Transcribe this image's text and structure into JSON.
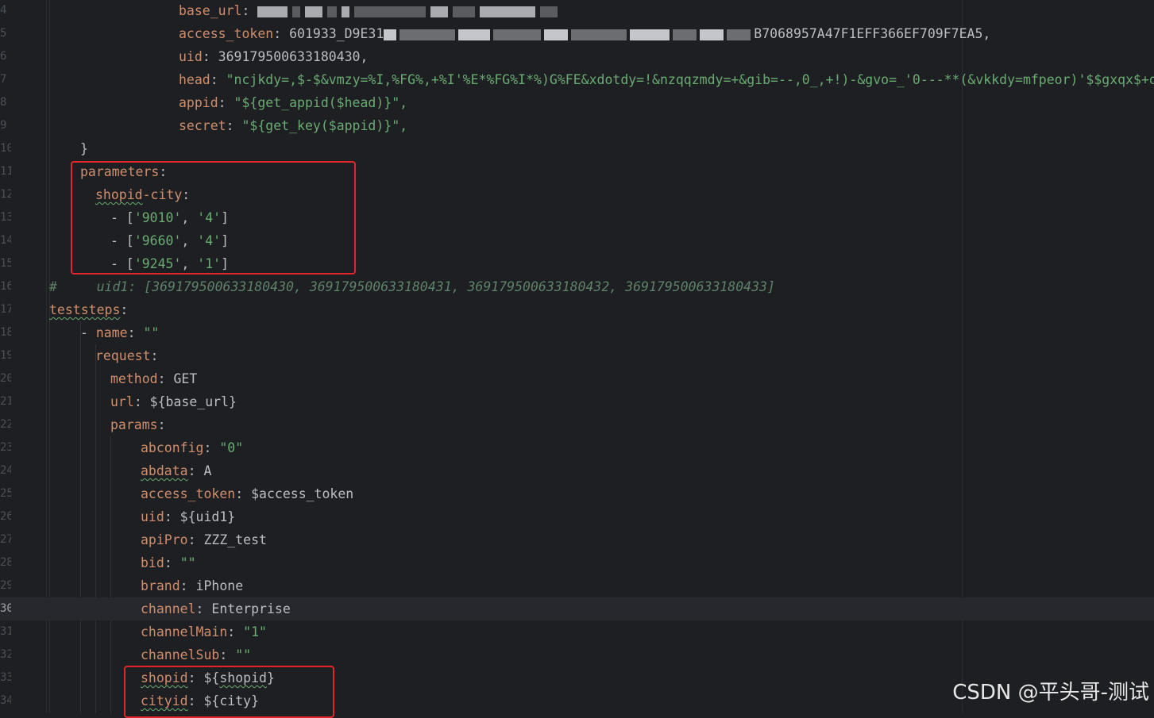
{
  "editor": {
    "lines": [
      {
        "num": "4",
        "indent": 225,
        "parts": [
          [
            "k",
            "base_url"
          ],
          [
            "p",
            ": "
          ]
        ],
        "blur": "base"
      },
      {
        "num": "5",
        "indent": 225,
        "parts": [
          [
            "k",
            "access_token"
          ],
          [
            "p",
            ": 601933_D9E31"
          ]
        ],
        "blur": "token",
        "tail": "B7068957A47F1EFF366EF709F7EA5,"
      },
      {
        "num": "6",
        "indent": 225,
        "parts": [
          [
            "k",
            "uid"
          ],
          [
            "p",
            ": 369179500633180430,"
          ]
        ]
      },
      {
        "num": "7",
        "indent": 225,
        "parts": [
          [
            "k",
            "head"
          ],
          [
            "p",
            ": "
          ],
          [
            "s",
            "\"ncjkdy=,$-$&vmzy=%I,%FG%,+%I'%E*%FG%I*%)G%FE&xdotdy=!&nzqqzmdy=+&gib=--,0_,+!)-&gvo=_'0---**(&vkkdy=mfpeor)'$$gxqx$+oac\","
          ]
        ]
      },
      {
        "num": "8",
        "indent": 225,
        "parts": [
          [
            "k",
            "appid"
          ],
          [
            "p",
            ": "
          ],
          [
            "s",
            "\"${get_appid($head)}\","
          ]
        ]
      },
      {
        "num": "9",
        "indent": 225,
        "parts": [
          [
            "k",
            "secret"
          ],
          [
            "p",
            ": "
          ],
          [
            "s",
            "\"${get_key($appid)}\","
          ]
        ]
      },
      {
        "num": "10",
        "indent": 101,
        "parts": [
          [
            "p",
            "}"
          ]
        ]
      },
      {
        "num": "11",
        "indent": 101,
        "parts": [
          [
            "k",
            "parameters"
          ],
          [
            "p",
            ":"
          ]
        ]
      },
      {
        "num": "12",
        "indent": 120,
        "parts": [
          [
            "kw",
            "shopid"
          ],
          [
            "k",
            "-city"
          ],
          [
            "p",
            ":"
          ]
        ]
      },
      {
        "num": "13",
        "indent": 139,
        "parts": [
          [
            "p",
            "- ["
          ],
          [
            "s",
            "'9010'"
          ],
          [
            "p",
            ", "
          ],
          [
            "s",
            "'4'"
          ],
          [
            "p",
            "]"
          ]
        ]
      },
      {
        "num": "14",
        "indent": 139,
        "parts": [
          [
            "p",
            "- ["
          ],
          [
            "s",
            "'9660'"
          ],
          [
            "p",
            ", "
          ],
          [
            "s",
            "'4'"
          ],
          [
            "p",
            "]"
          ]
        ]
      },
      {
        "num": "15",
        "indent": 139,
        "parts": [
          [
            "p",
            "- ["
          ],
          [
            "s",
            "'9245'"
          ],
          [
            "p",
            ", "
          ],
          [
            "s",
            "'1'"
          ],
          [
            "p",
            "]"
          ]
        ]
      },
      {
        "num": "16",
        "indent": 62,
        "parts": [
          [
            "c",
            "#     uid1: [369179500633180430, 369179500633180431, 369179500633180432, 369179500633180433]"
          ]
        ]
      },
      {
        "num": "17",
        "indent": 62,
        "parts": [
          [
            "kw",
            "teststeps"
          ],
          [
            "p",
            ":"
          ]
        ]
      },
      {
        "num": "18",
        "indent": 101,
        "parts": [
          [
            "p",
            "- "
          ],
          [
            "k",
            "name"
          ],
          [
            "p",
            ": "
          ],
          [
            "s",
            "\"\""
          ]
        ]
      },
      {
        "num": "19",
        "indent": 120,
        "parts": [
          [
            "k",
            "request"
          ],
          [
            "p",
            ":"
          ]
        ]
      },
      {
        "num": "20",
        "indent": 139,
        "parts": [
          [
            "k",
            "method"
          ],
          [
            "p",
            ": GET"
          ]
        ]
      },
      {
        "num": "21",
        "indent": 139,
        "parts": [
          [
            "k",
            "url"
          ],
          [
            "p",
            ": ${base_url}"
          ]
        ]
      },
      {
        "num": "22",
        "indent": 139,
        "parts": [
          [
            "k",
            "params"
          ],
          [
            "p",
            ":"
          ]
        ]
      },
      {
        "num": "23",
        "indent": 177,
        "parts": [
          [
            "k",
            "abconfig"
          ],
          [
            "p",
            ": "
          ],
          [
            "s",
            "\"0\""
          ]
        ]
      },
      {
        "num": "24",
        "indent": 177,
        "parts": [
          [
            "kw",
            "abdata"
          ],
          [
            "p",
            ": A"
          ]
        ]
      },
      {
        "num": "25",
        "indent": 177,
        "parts": [
          [
            "k",
            "access_token"
          ],
          [
            "p",
            ": $access_token"
          ]
        ]
      },
      {
        "num": "26",
        "indent": 177,
        "parts": [
          [
            "k",
            "uid"
          ],
          [
            "p",
            ": ${uid1}"
          ]
        ]
      },
      {
        "num": "27",
        "indent": 177,
        "parts": [
          [
            "k",
            "apiPro"
          ],
          [
            "p",
            ": ZZZ_test"
          ]
        ]
      },
      {
        "num": "28",
        "indent": 177,
        "parts": [
          [
            "k",
            "bid"
          ],
          [
            "p",
            ": "
          ],
          [
            "s",
            "\"\""
          ]
        ]
      },
      {
        "num": "29",
        "indent": 177,
        "parts": [
          [
            "k",
            "brand"
          ],
          [
            "p",
            ": iPhone"
          ]
        ]
      },
      {
        "num": "30",
        "indent": 177,
        "parts": [
          [
            "k",
            "channel"
          ],
          [
            "p",
            ": Enterprise"
          ]
        ],
        "current": true
      },
      {
        "num": "31",
        "indent": 177,
        "parts": [
          [
            "k",
            "channelMain"
          ],
          [
            "p",
            ": "
          ],
          [
            "s",
            "\"1\""
          ]
        ]
      },
      {
        "num": "32",
        "indent": 177,
        "parts": [
          [
            "k",
            "channelSub"
          ],
          [
            "p",
            ": "
          ],
          [
            "s",
            "\"\""
          ]
        ]
      },
      {
        "num": "33",
        "indent": 177,
        "parts": [
          [
            "kw",
            "shopid"
          ],
          [
            "p",
            ": ${"
          ],
          [
            "pw",
            "shopid"
          ],
          [
            "p",
            "}"
          ]
        ]
      },
      {
        "num": "34",
        "indent": 177,
        "parts": [
          [
            "kw",
            "cityid"
          ],
          [
            "p",
            ": ${city}"
          ]
        ]
      }
    ]
  },
  "colors": {
    "background": "#1e1f22",
    "key": "#cf8e6d",
    "string": "#6aab73",
    "plain": "#bcbec4",
    "comment": "#5f826b",
    "highlight_box": "#e3262b"
  },
  "watermark": "CSDN @平头哥-测试"
}
